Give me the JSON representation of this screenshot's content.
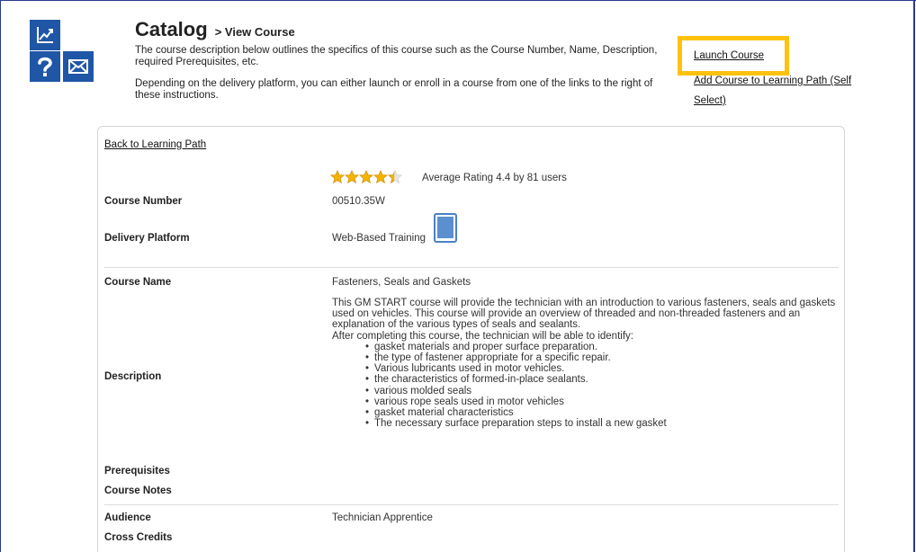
{
  "page": {
    "title": "Catalog",
    "crumb": "> View Course",
    "intro": "The course description below outlines the specifics of this course such as the Course Number, Name, Description, required Prerequisites, etc.",
    "intro2": "Depending on the delivery platform, you can either launch or enroll in a course from one of the links to the right of these instructions."
  },
  "actions": {
    "launch": "Launch Course",
    "add": "Add Course to Learning Path (Self Select)"
  },
  "icons": {
    "chart": "line-chart-icon",
    "help": "question-mark-icon",
    "mail": "envelope-icon"
  },
  "colors": {
    "icon_bg": "#1f56a6",
    "highlight": "#ffc20e",
    "star": "#f4b400"
  },
  "course": {
    "back": "Back to Learning Path",
    "rating": {
      "value": 4.4,
      "max": 5,
      "text": "Average Rating 4.4 by 81 users"
    },
    "number_label": "Course Number",
    "number": "00510.35W",
    "platform_label": "Delivery Platform",
    "platform": "Web-Based Training",
    "name_label": "Course Name",
    "name": "Fasteners, Seals and Gaskets",
    "desc_label": "Description",
    "desc_p1": "This GM START course will provide the technician with an introduction to various fasteners, seals and gaskets used on vehicles. This course will provide an overview of threaded and non-threaded fasteners and an explanation of the various types of seals and sealants.",
    "desc_p2": "After completing this course, the technician will be able to identify:",
    "desc_items": [
      "gasket materials and proper surface preparation.",
      "the type of fastener appropriate for a specific repair.",
      "Various lubricants used in motor vehicles.",
      "the characteristics of formed-in-place sealants.",
      "various molded seals",
      "various rope seals used in motor vehicles",
      "gasket material characteristics",
      "The necessary surface preparation steps to install a new gasket"
    ],
    "prereq_label": "Prerequisites",
    "notes_label": "Course Notes",
    "audience_label": "Audience",
    "audience": "Technician Apprentice",
    "credits_label": "Cross Credits"
  }
}
